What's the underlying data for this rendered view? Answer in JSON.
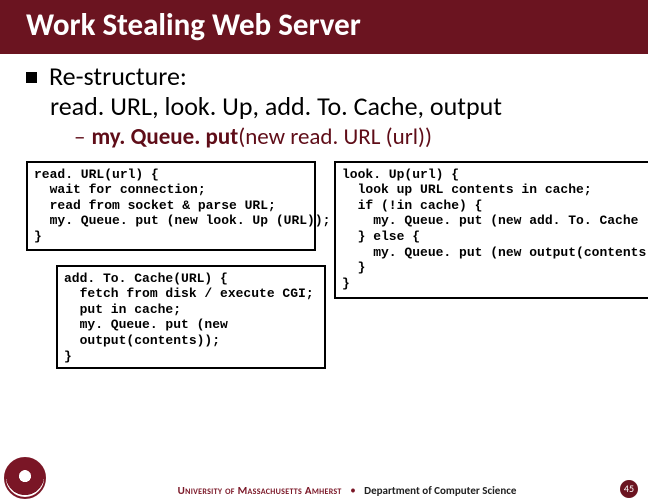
{
  "title": "Work Stealing Web Server",
  "bullet_main": "Re-structure:",
  "bullet_sub": "read. URL, look. Up, add. To. Cache, output",
  "dash_prefix": "– ",
  "dash_bold": "my. Queue. put",
  "dash_rest": "(new read. URL (url))",
  "code_read": "read. URL(url) {\n  wait for connection;\n  read from socket & parse URL;\n  my. Queue. put (new look. Up (URL));\n}",
  "code_lookup": "look. Up(url) {\n  look up URL contents in cache;\n  if (!in cache) {\n    my. Queue. put (new add. To. Cache (URL));\n  } else {\n    my. Queue. put (new output(contents));\n  }\n}",
  "code_add": "add. To. Cache(URL) {\n  fetch from disk / execute CGI;\n  put in cache;\n  my. Queue. put (new\n  output(contents));\n}",
  "footer_uni": "University of Massachusetts Amherst",
  "footer_dept": "Department of Computer Science",
  "page_number": "45"
}
